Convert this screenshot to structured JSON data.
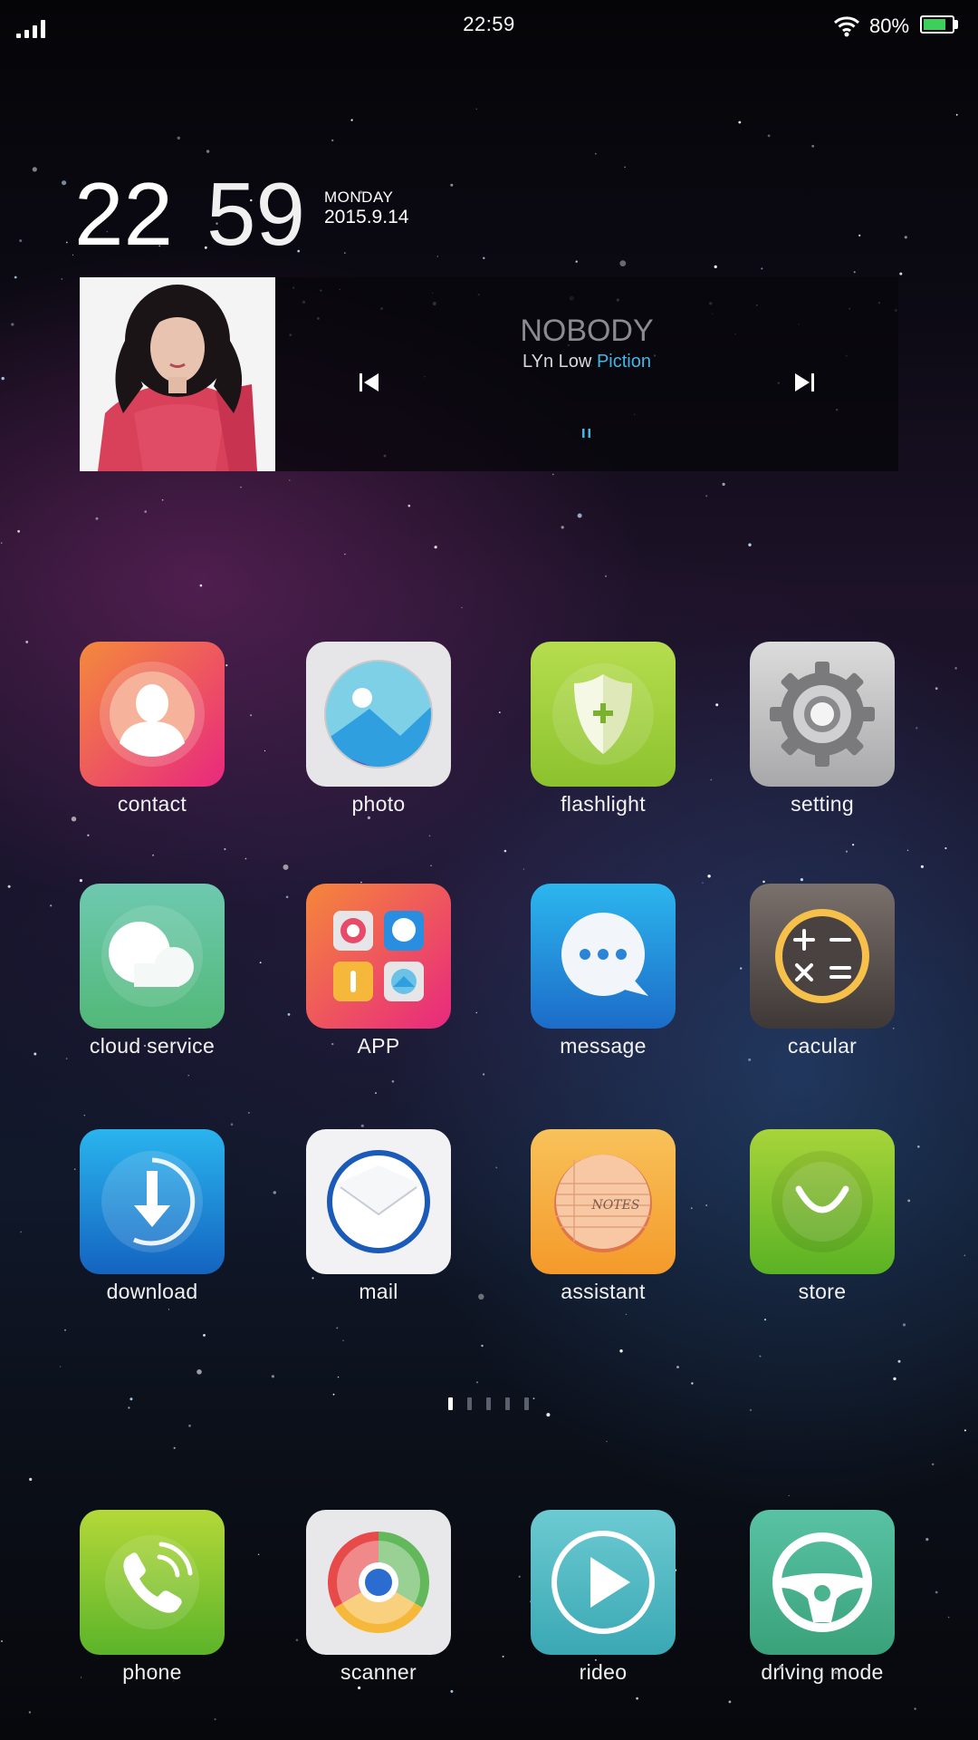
{
  "status_bar": {
    "time": "22:59",
    "battery": "80%",
    "battery_level": 0.8
  },
  "clock": {
    "hour": "22",
    "minute": "59",
    "day": "MONDAY",
    "date": "2015.9.14"
  },
  "music": {
    "title": "NOBODY",
    "artist": "LYn Low",
    "album": "Piction"
  },
  "apps": [
    {
      "label": "contact",
      "icon": "contact-icon"
    },
    {
      "label": "photo",
      "icon": "photo-icon"
    },
    {
      "label": "flashlight",
      "icon": "flashlight-icon"
    },
    {
      "label": "setting",
      "icon": "setting-icon"
    },
    {
      "label": "cloud service",
      "icon": "cloud-icon"
    },
    {
      "label": "APP",
      "icon": "app-folder-icon"
    },
    {
      "label": "message",
      "icon": "message-icon"
    },
    {
      "label": "cacular",
      "icon": "calculator-icon"
    },
    {
      "label": "download",
      "icon": "download-icon"
    },
    {
      "label": "mail",
      "icon": "mail-icon"
    },
    {
      "label": "assistant",
      "icon": "notes-icon"
    },
    {
      "label": "store",
      "icon": "store-icon"
    }
  ],
  "dock": [
    {
      "label": "phone",
      "icon": "phone-icon"
    },
    {
      "label": "scanner",
      "icon": "scanner-icon"
    },
    {
      "label": "rideo",
      "icon": "video-icon"
    },
    {
      "label": "driving mode",
      "icon": "steering-wheel-icon"
    }
  ],
  "pager": {
    "pages": 5,
    "current": 1
  }
}
